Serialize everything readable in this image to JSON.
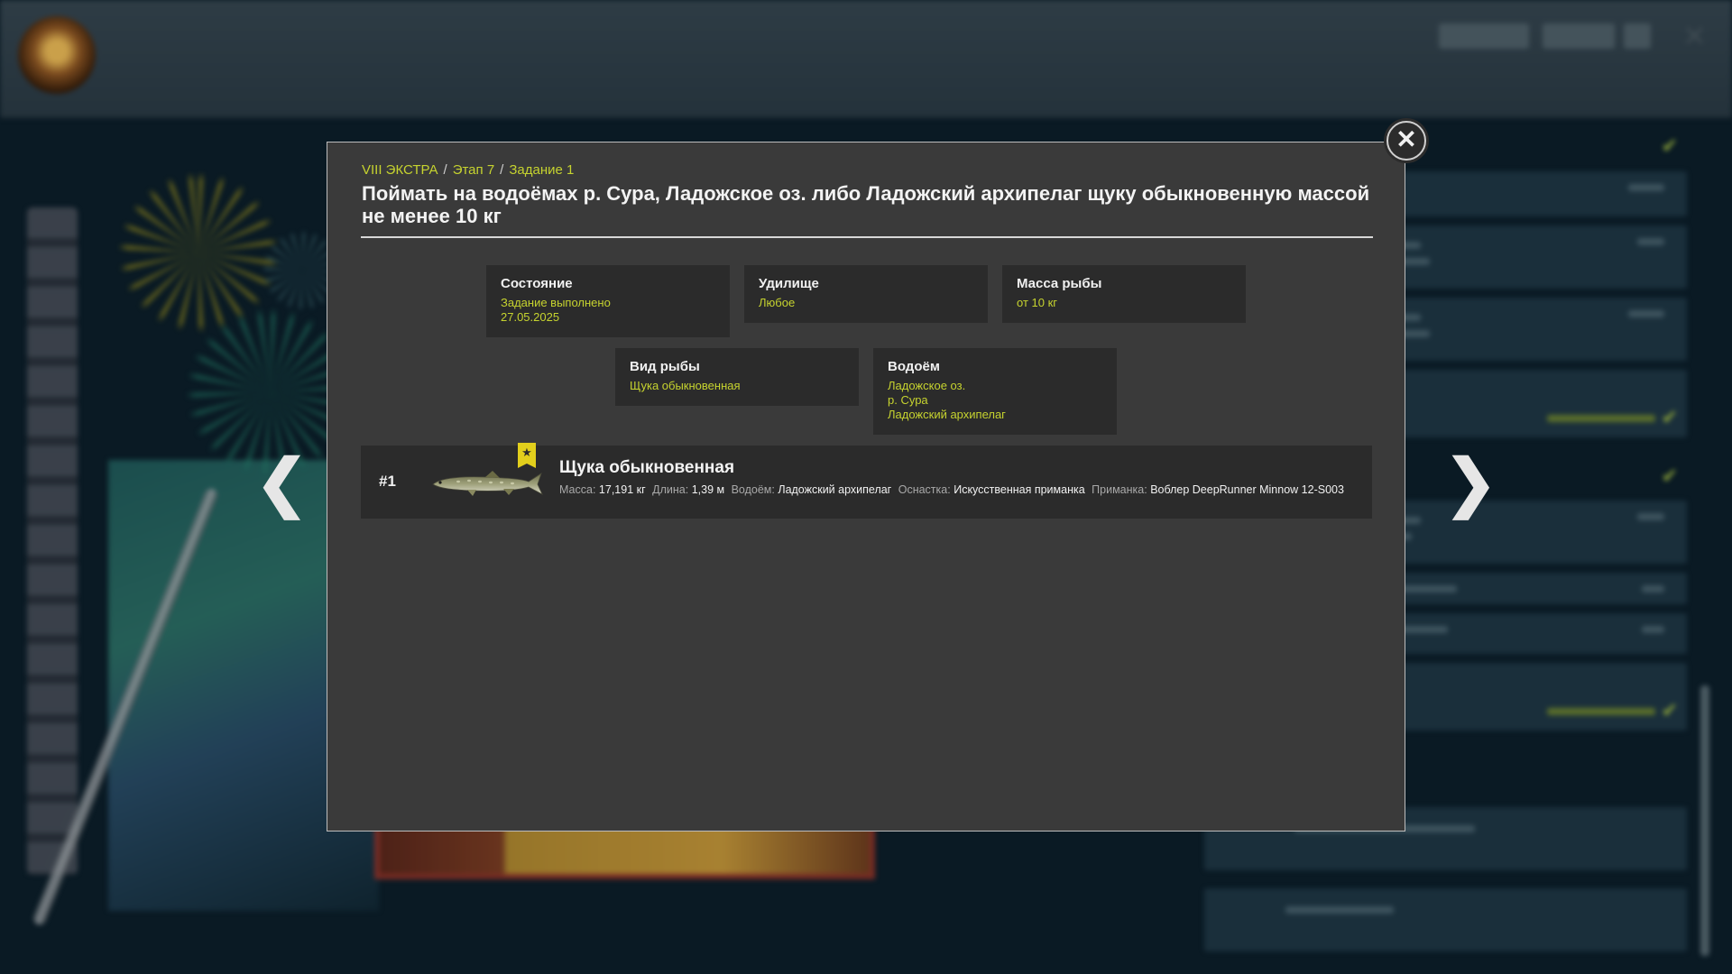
{
  "background": {
    "player": {
      "level": "",
      "name": "",
      "subtitle": ""
    },
    "screen_title": "",
    "currency_1": "",
    "currency_2": ""
  },
  "modal": {
    "breadcrumb": [
      "VIII ЭКСТРА",
      "Этап 7",
      "Задание 1"
    ],
    "breadcrumb_sep": "/",
    "title": "Поймать на водоёмах р. Сура, Ладожское оз. либо Ладожский архипелаг щуку обыкновенную массой не менее 10 кг",
    "info": {
      "state": {
        "label": "Состояние",
        "value": "Задание выполнено",
        "date": "27.05.2025"
      },
      "rod": {
        "label": "Удилище",
        "value": "Любое"
      },
      "mass": {
        "label": "Масса рыбы",
        "value": "от 10 кг"
      },
      "fish": {
        "label": "Вид рыбы",
        "value": "Щука обыкновенная"
      },
      "water": {
        "label": "Водоём",
        "values": [
          "Ладожское оз.",
          "р. Сура",
          "Ладожский архипелаг"
        ]
      }
    },
    "result": {
      "rank": "#1",
      "fish_name": "Щука обыкновенная",
      "mass_label": "Масса:",
      "mass": "17,191 кг",
      "length_label": "Длина:",
      "length": "1,39 м",
      "water_label": "Водоём:",
      "water": "Ладожский архипелаг",
      "tackle_label": "Оснастка:",
      "tackle": "Искусственная приманка",
      "bait_label": "Приманка:",
      "bait": "Воблер DeepRunner Minnow 12-S003"
    }
  },
  "icons": {
    "close": "close-icon",
    "prev": "chevron-left-icon",
    "next": "chevron-right-icon",
    "star": "star-icon",
    "check": "checkmark-icon"
  },
  "colors": {
    "accent": "#c6d32f",
    "panel": "#3a3a3a",
    "card": "#2b2b2b",
    "badge": "#e2cf1c"
  }
}
